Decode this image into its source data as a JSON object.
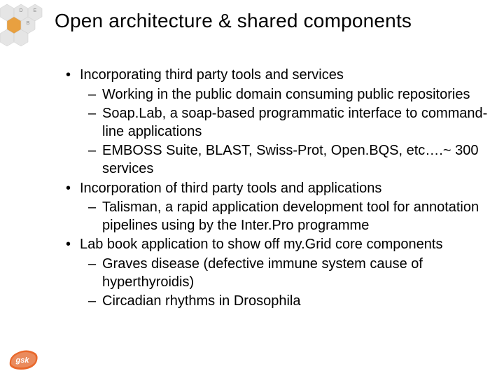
{
  "title": "Open architecture & shared components",
  "bullets": {
    "a": "Incorporating third party tools and services",
    "a1": "Working in the public domain consuming public repositories",
    "a2": "Soap.Lab, a soap-based programmatic interface to command-line applications",
    "a3": "EMBOSS Suite, BLAST, Swiss-Prot, Open.BQS, etc….~ 300 services",
    "b": "Incorporation of third party tools and applications",
    "b1": "Talisman, a rapid application development tool for annotation pipelines using by the Inter.Pro programme",
    "c": "Lab book application to show off my.Grid core components",
    "c1": "Graves disease (defective immune system cause of hyperthyroidis)",
    "c2": "Circadian rhythms in Drosophila"
  },
  "decor": {
    "hex_letters": [
      "D",
      "E",
      "B"
    ]
  },
  "logo": {
    "name": "gsk"
  }
}
